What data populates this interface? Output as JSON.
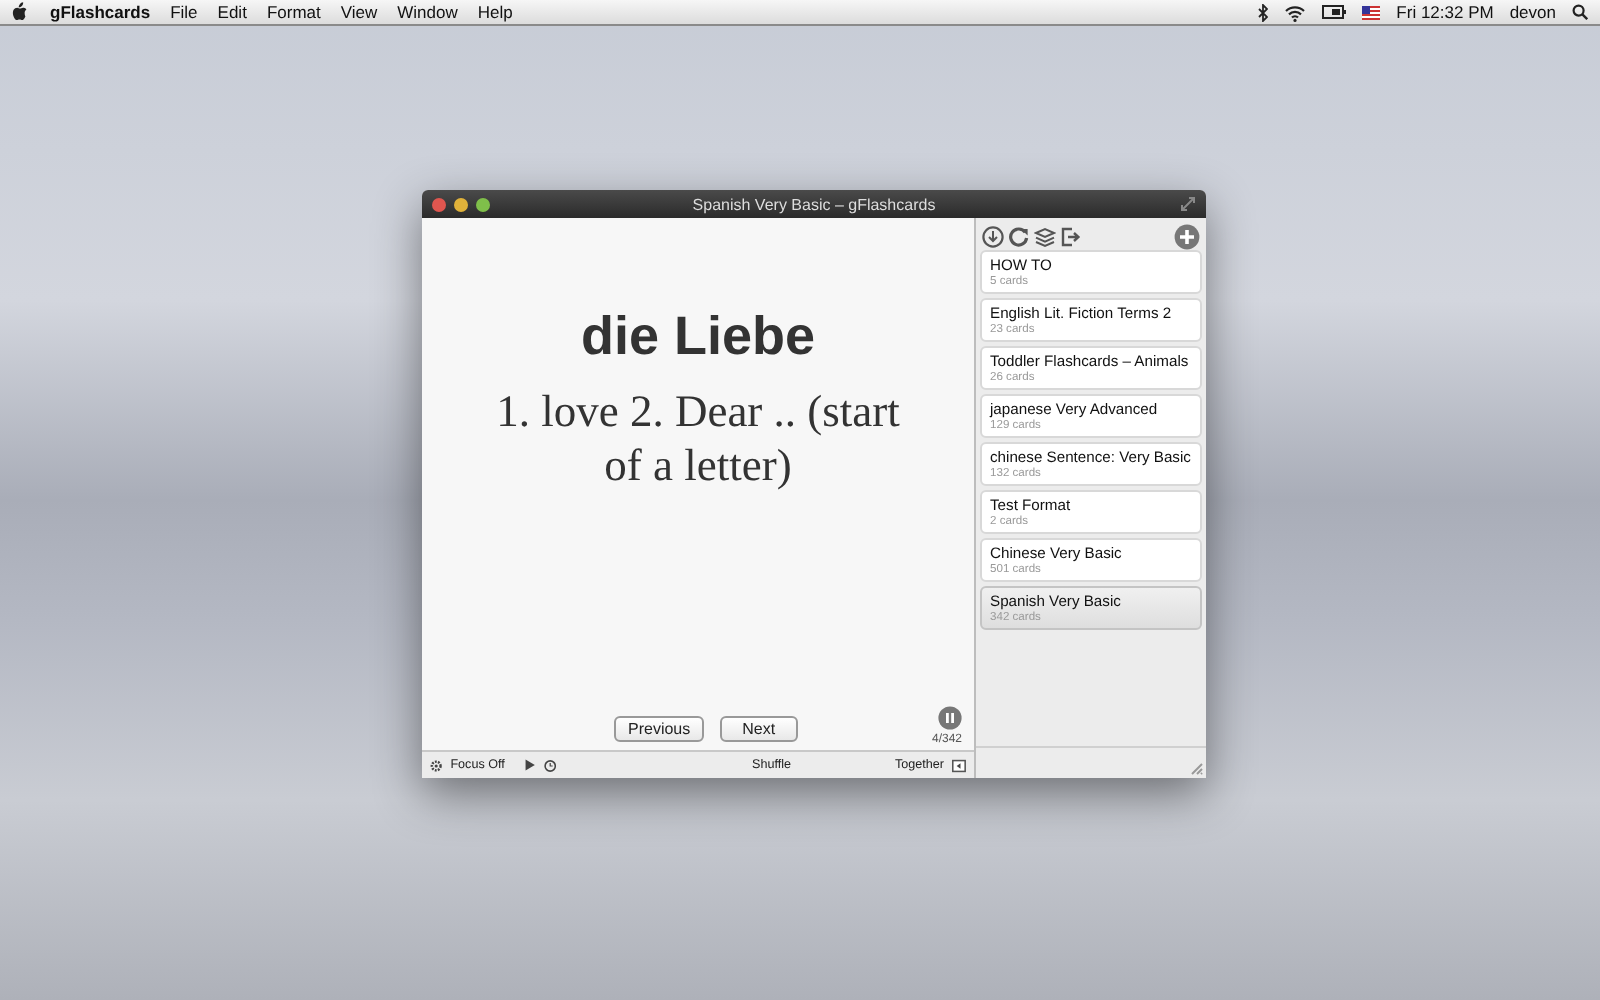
{
  "menu_bar": {
    "app_name": "gFlashcards",
    "menus": [
      "File",
      "Edit",
      "Format",
      "View",
      "Window",
      "Help"
    ],
    "clock": "Fri 12:32 PM",
    "user": "devon"
  },
  "window": {
    "title": "Spanish Very Basic – gFlashcards"
  },
  "card": {
    "front": "die Liebe",
    "back": "1. love 2. Dear .. (start of a letter)"
  },
  "navigation": {
    "previous": "Previous",
    "next": "Next",
    "progress": "4/342"
  },
  "bottom_bar": {
    "focus": "Focus Off",
    "shuffle": "Shuffle",
    "together": "Together"
  },
  "decks": [
    {
      "name": "HOW TO",
      "count": "5 cards",
      "selected": false
    },
    {
      "name": "English Lit. Fiction Terms 2",
      "count": "23 cards",
      "selected": false
    },
    {
      "name": "Toddler Flashcards – Animals",
      "count": "26 cards",
      "selected": false
    },
    {
      "name": "japanese Very Advanced",
      "count": "129 cards",
      "selected": false
    },
    {
      "name": "chinese Sentence: Very Basic",
      "count": "132 cards",
      "selected": false
    },
    {
      "name": "Test Format",
      "count": "2 cards",
      "selected": false
    },
    {
      "name": "Chinese Very Basic",
      "count": "501 cards",
      "selected": false
    },
    {
      "name": "Spanish Very Basic",
      "count": "342 cards",
      "selected": true
    }
  ]
}
